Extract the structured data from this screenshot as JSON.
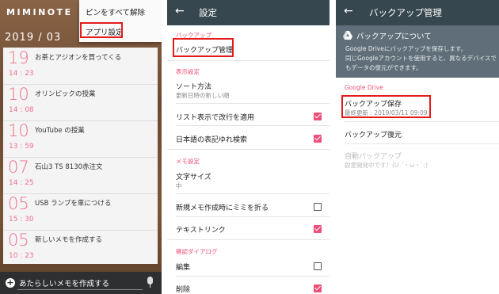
{
  "panel1": {
    "brand": "MIMINOTE",
    "month": "2019 / 03",
    "menu": {
      "item1": "ピンをすべて解除",
      "item2": "アプリ設定"
    },
    "memos": [
      {
        "day": "19",
        "time": "14 : 23",
        "title": "お茶とアジオンを買ってくる"
      },
      {
        "day": "10",
        "time": "14 : 08",
        "title": "オリンピックの授業"
      },
      {
        "day": "10",
        "time": "13 : 59",
        "title": "YouTube の授業"
      },
      {
        "day": "07",
        "time": "14 : 25",
        "title": "石山3 TS 8130赤注文"
      },
      {
        "day": "05",
        "time": "15 : 30",
        "title": "USB ランプを車につける"
      },
      {
        "day": "05",
        "time": "10 : 23",
        "title": "新しいメモを作成する"
      }
    ],
    "new_memo_placeholder": "あたらしいメモを作成する",
    "highlight_color": "#e31b1b",
    "accent_color": "#f06f8e"
  },
  "panel2": {
    "title": "設定",
    "sections": {
      "backup": "バックアップ",
      "display": "表示設定",
      "memo": "メモ設定",
      "confirm": "確認ダイアログ"
    },
    "items": {
      "backup_manage": "バックアップ管理",
      "sort": "ソート方法",
      "sort_sub": "更新日時の新しい順",
      "list_wrap": "リスト表示で改行を適用",
      "jp_fuzzy": "日本語の表記ゆれ検索",
      "font_size": "文字サイズ",
      "font_size_sub": "中",
      "fold_new": "新規メモ作成時にミミを折る",
      "textlink": "テキストリンク",
      "edit": "編集",
      "delete": "削除"
    },
    "checkboxes": {
      "list_wrap": true,
      "jp_fuzzy": true,
      "fold_new": false,
      "textlink": true,
      "edit": false,
      "delete": true
    },
    "accent_color": "#ef4f78"
  },
  "panel3": {
    "title": "バックアップ管理",
    "info_header": "バックアップについて",
    "info_lines": [
      "Google Driveにバックアップを保存します。",
      "同じGoogleアカウントを使用すると、異なるデバイスで",
      "もデータの復元ができます。"
    ],
    "section": "Google Drive",
    "save": "バックアップ保存",
    "save_sub": "最終更新 : 2019/03/11 09:09",
    "restore": "バックアップ復元",
    "auto": "自動バックアップ",
    "auto_sub": "鋭意開発中です！(U ´・ω・`;)"
  }
}
